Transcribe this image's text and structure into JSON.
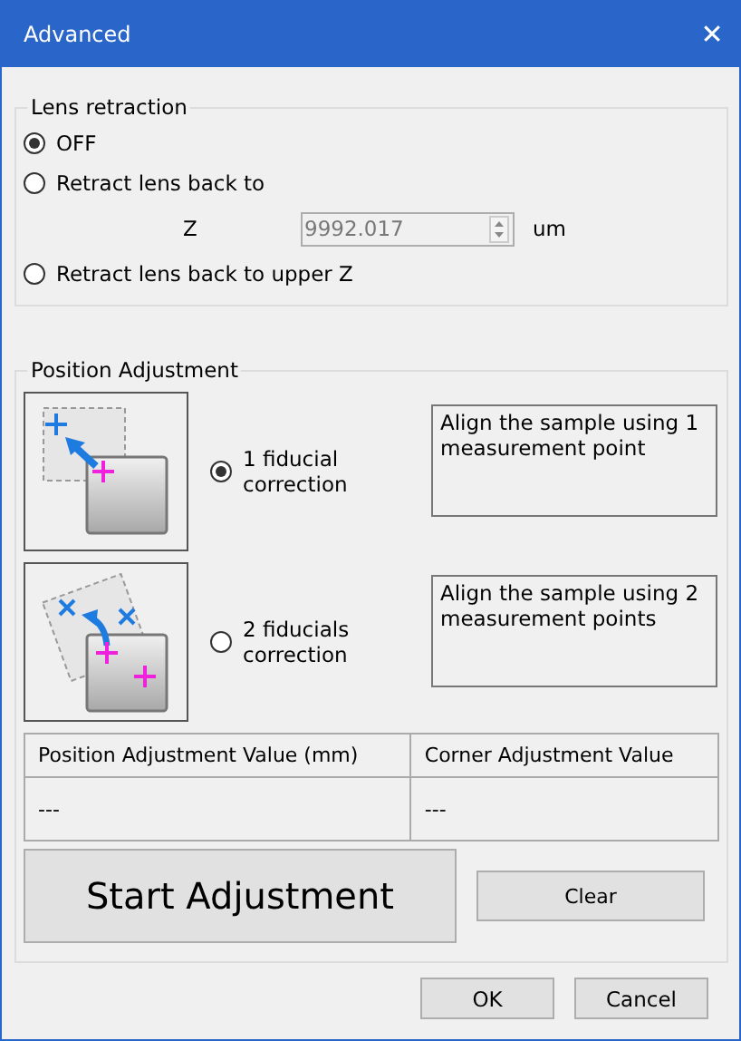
{
  "window": {
    "title": "Advanced",
    "close": "✕"
  },
  "lens_retraction": {
    "title": "Lens retraction",
    "options": [
      {
        "label": "OFF",
        "selected": true
      },
      {
        "label": "Retract lens back to",
        "selected": false
      },
      {
        "label": "Retract lens back to upper Z",
        "selected": false
      }
    ],
    "z_label": "Z",
    "z_value": "9992.017",
    "z_disabled": true,
    "unit": "um"
  },
  "position_adjustment": {
    "title": "Position Adjustment",
    "modes": [
      {
        "kind": "one_point",
        "label": "1 fiducial correction",
        "selected": true,
        "description": "Align the sample using 1 measurement point"
      },
      {
        "kind": "two_point",
        "label": "2 fiducials correction",
        "selected": false,
        "description": "Align the sample using 2 measurement points"
      }
    ],
    "table": {
      "columns": [
        "Position Adjustment Value (mm)",
        "Corner Adjustment Value"
      ],
      "rows": [
        [
          "---",
          "---"
        ]
      ]
    },
    "start_button": "Start Adjustment",
    "clear_button": "Clear"
  },
  "buttons": [
    "OK",
    "Cancel"
  ]
}
